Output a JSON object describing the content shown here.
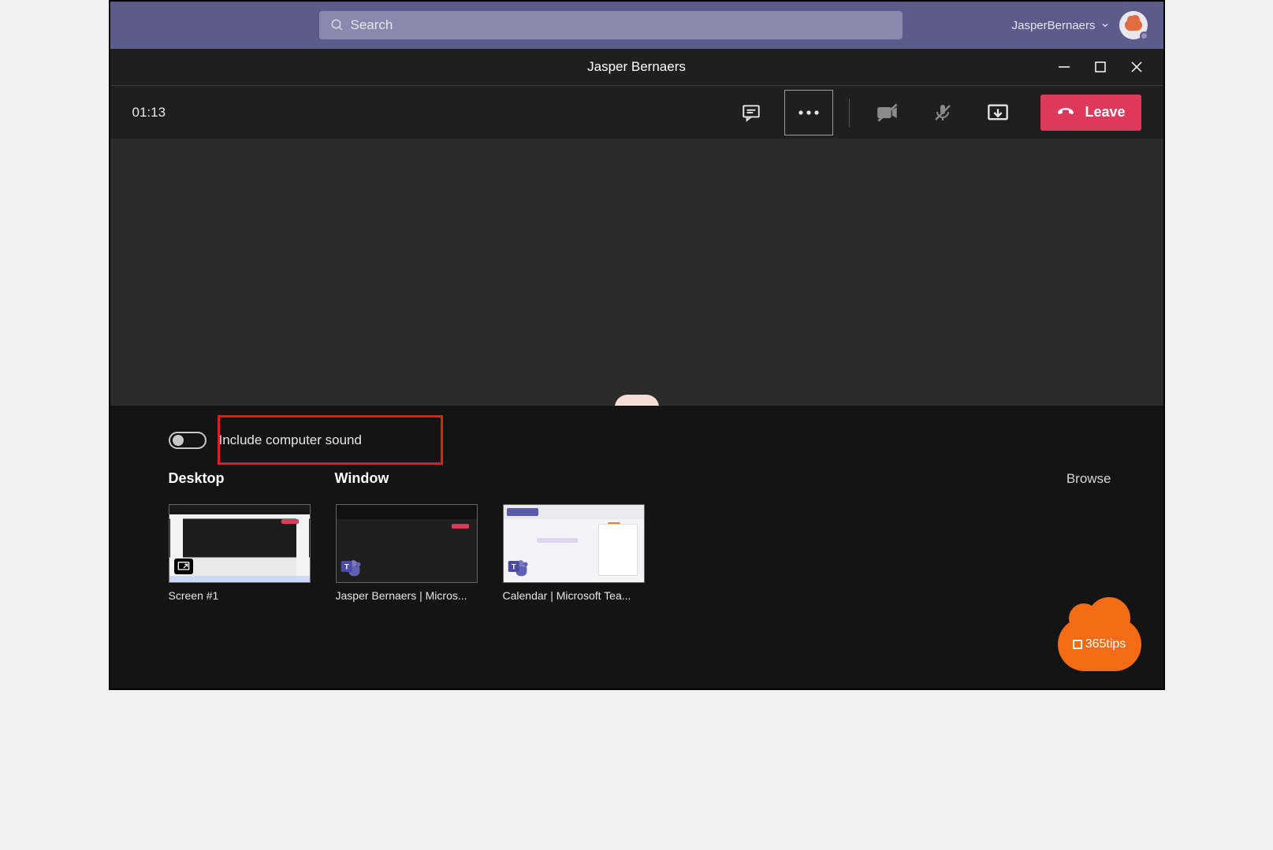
{
  "topbar": {
    "search_placeholder": "Search",
    "username": "JasperBernaers"
  },
  "call": {
    "title": "Jasper Bernaers",
    "timer": "01:13",
    "leave_label": "Leave"
  },
  "share_tray": {
    "include_sound_label": "Include computer sound",
    "include_sound_on": false,
    "tabs": {
      "desktop": "Desktop",
      "window": "Window"
    },
    "browse_label": "Browse",
    "thumbs": [
      {
        "label": "Screen #1"
      },
      {
        "label": "Jasper Bernaers | Micros..."
      },
      {
        "label": "Calendar | Microsoft Tea..."
      }
    ]
  },
  "watermark": {
    "label": "365tips"
  }
}
